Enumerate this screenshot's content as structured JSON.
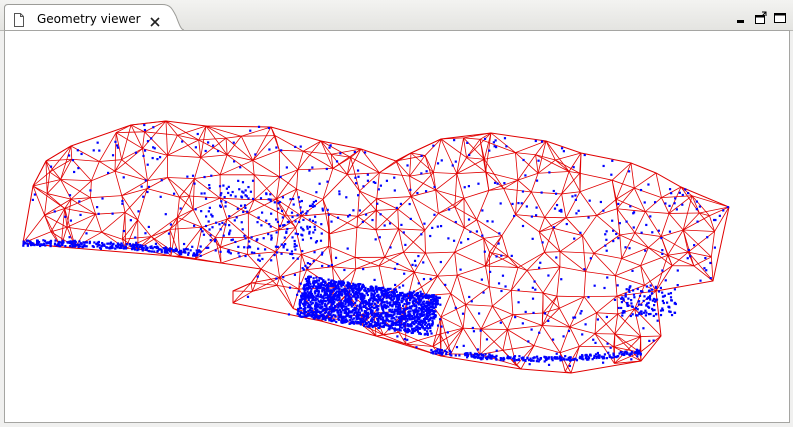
{
  "view": {
    "title": "Geometry viewer",
    "tab_icon": "document-icon",
    "close_icon": "close-icon",
    "window_controls": [
      "minimize-icon",
      "restore-icon",
      "maximize-icon"
    ]
  },
  "viewer": {
    "mesh_color": "#e00000",
    "point_color": "#0000ff",
    "background": "#ffffff"
  }
}
